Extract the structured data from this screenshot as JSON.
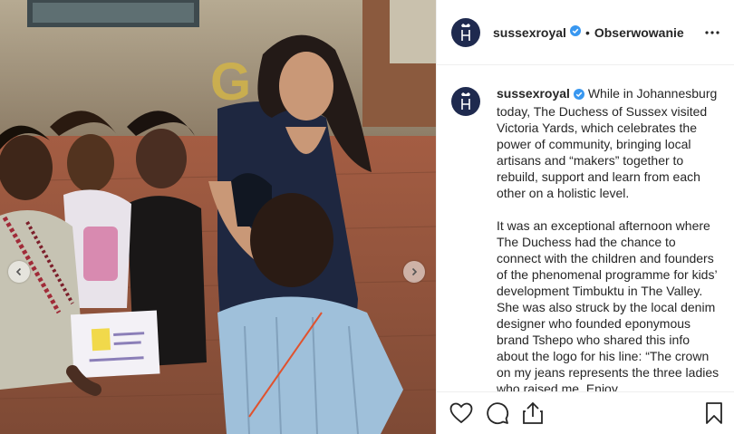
{
  "post": {
    "account": {
      "username": "sussexroyal",
      "follow_separator": "•",
      "follow_label": "Obserwowanie",
      "brand_color": "#1f2a4f",
      "verified_color": "#3897f0"
    },
    "caption": {
      "username": "sussexroyal",
      "paragraphs": [
        "While in Johannesburg today, The Duchess of Sussex visited Victoria Yards, which celebrates the power of community, bringing local artisans and “makers” together to rebuild, support and learn from each other on a holistic level.",
        "It was an exceptional afternoon where The Duchess had the chance to connect with the children and founders of the phenomenal programme for kids’ development Timbuktu in The Valley. She was also struck by the local denim designer who founded eponymous brand Tshepo who shared this info about the logo for his line: “The crown on my jeans represents the three ladies who raised me. Enjoy"
      ]
    },
    "icons": {
      "more": "more-options-icon",
      "like": "heart-icon",
      "comment": "comment-icon",
      "share": "share-icon",
      "save": "bookmark-icon",
      "verified": "verified-badge-icon",
      "prev": "chevron-left-icon",
      "next": "chevron-right-icon"
    }
  }
}
